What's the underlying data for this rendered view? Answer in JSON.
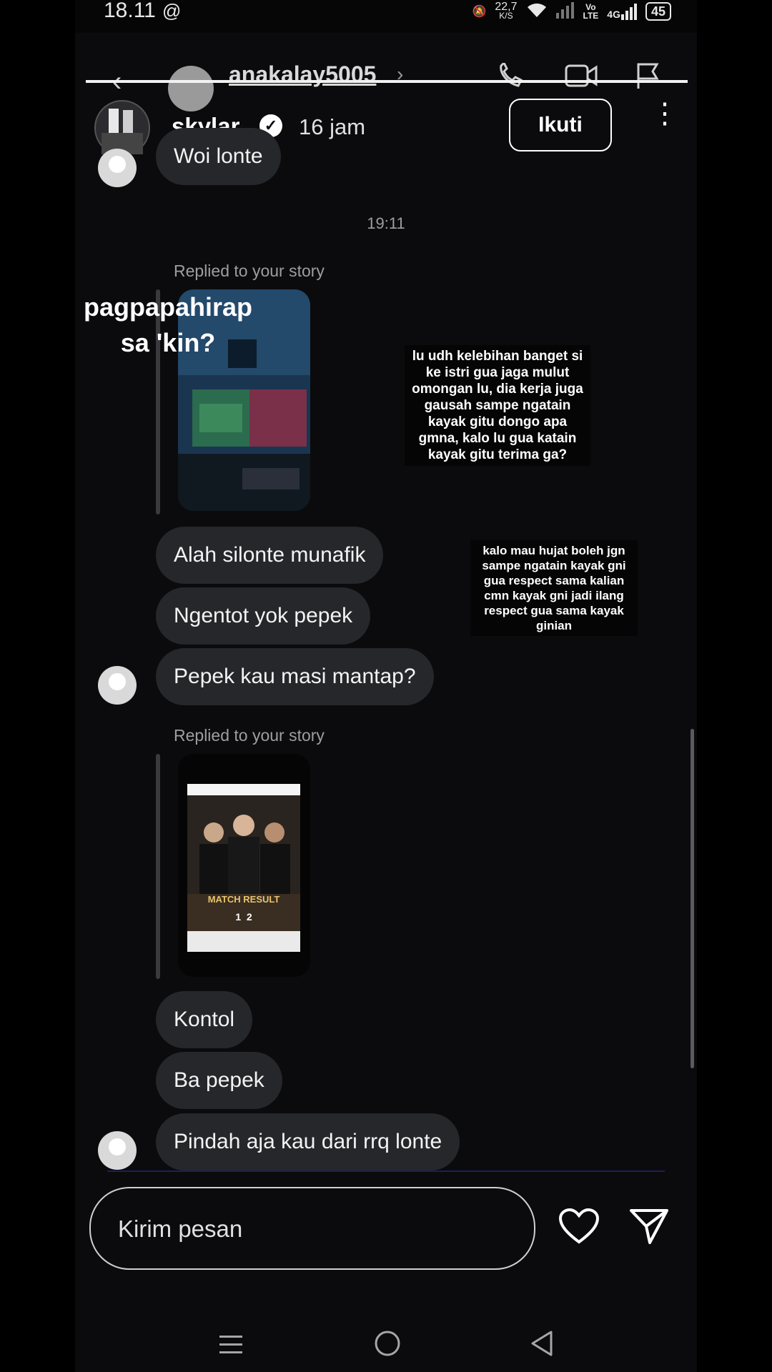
{
  "status_bar": {
    "time": "18.11",
    "app_icon": "threads-icon",
    "net_speed_value": "22,7",
    "net_speed_unit": "K/S",
    "volte_top": "Vo",
    "volte_bottom": "LTE",
    "network_type": "4G",
    "battery": "45"
  },
  "dm_header": {
    "username": "anakalay5005",
    "icons": [
      "back-icon",
      "call-icon",
      "video-icon",
      "flag-icon"
    ]
  },
  "story_header": {
    "username": "skylar_",
    "verified": true,
    "time_ago": "16 jam",
    "follow_label": "Ikuti"
  },
  "chat": {
    "messages_a": [
      "Woi lonte"
    ],
    "timestamp": "19:11",
    "reply_label_1": "Replied to your story",
    "messages_b": [
      "Alah silonte munafik",
      "Ngentot yok pepek",
      "Pepek kau masi mantap?"
    ],
    "reply_label_2": "Replied to your story",
    "story2_headline": "MATCH RESULT",
    "story2_score": "1  2",
    "messages_c": [
      "Kontol",
      "Ba pepek",
      "Pindah aja kau dari rrq lonte"
    ]
  },
  "overlays": {
    "white_caption_1": "pagpapahirap",
    "white_caption_2": "sa 'kin?",
    "box_1": "lu udh kelebihan banget si ke istri gua jaga mulut omongan lu, dia kerja juga gausah sampe ngatain kayak gitu dongo apa gmna, kalo lu gua katain kayak gitu terima ga?",
    "box_2": "kalo mau hujat boleh jgn sampe ngatain kayak gni gua respect sama kalian cmn kayak gni jadi ilang respect gua sama kayak ginian"
  },
  "composer": {
    "placeholder": "Kirim pesan"
  },
  "colors": {
    "background": "#0b0b0d",
    "bubble": "#26272b",
    "secondary_text": "#9e9e9e"
  }
}
